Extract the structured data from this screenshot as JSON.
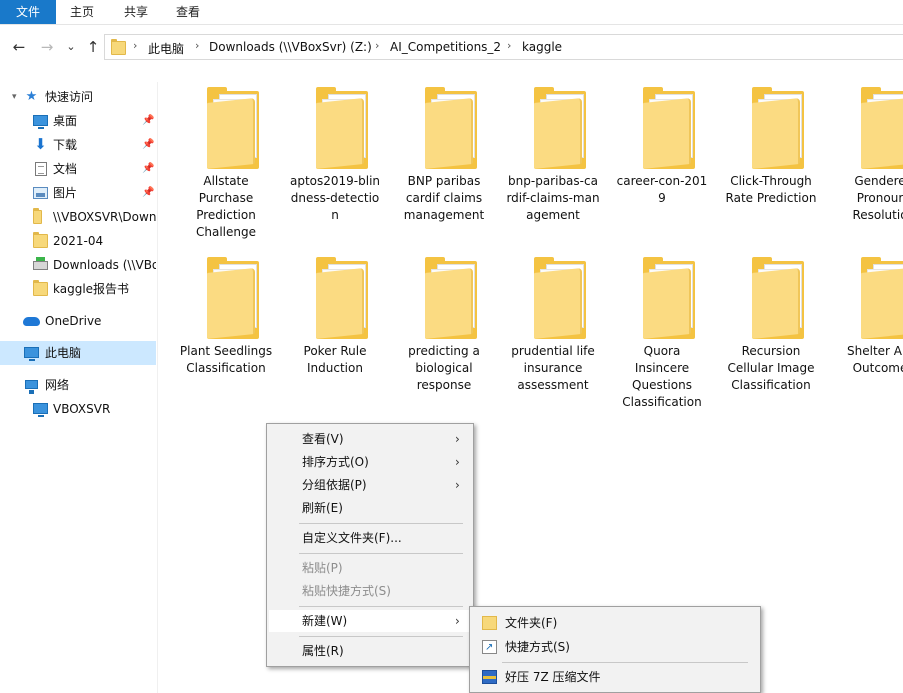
{
  "ribbon": {
    "tabs": [
      "文件",
      "主页",
      "共享",
      "查看"
    ]
  },
  "nav": {
    "back": "←",
    "forward": "→",
    "recent": "⌄",
    "up": "↑"
  },
  "address": {
    "segments": [
      "此电脑",
      "Downloads (\\\\VBoxSvr) (Z:)",
      "AI_Competitions_2",
      "kaggle"
    ],
    "separator": "›"
  },
  "sidebar": {
    "items": [
      {
        "label": "快速访问",
        "icon": "star-icon"
      },
      {
        "label": "桌面",
        "icon": "desktop-icon",
        "pinned": true
      },
      {
        "label": "下载",
        "icon": "download-icon",
        "pinned": true
      },
      {
        "label": "文档",
        "icon": "document-icon",
        "pinned": true
      },
      {
        "label": "图片",
        "icon": "picture-icon",
        "pinned": true
      },
      {
        "label": "\\\\VBOXSVR\\Down",
        "icon": "folder-icon"
      },
      {
        "label": "2021-04",
        "icon": "folder-icon"
      },
      {
        "label": "Downloads (\\\\VBo",
        "icon": "network-drive-icon"
      },
      {
        "label": "kaggle报告书",
        "icon": "folder-icon"
      },
      {
        "label": "OneDrive",
        "icon": "onedrive-icon"
      },
      {
        "label": "此电脑",
        "icon": "this-pc-icon",
        "selected": true
      },
      {
        "label": "网络",
        "icon": "network-icon"
      },
      {
        "label": "VBOXSVR",
        "icon": "computer-icon"
      }
    ],
    "pin_glyph": "📌"
  },
  "folders": [
    "Allstate Purchase Prediction Challenge",
    "aptos2019-blindness-detection",
    "BNP paribas cardif claims management",
    "bnp-paribas-cardif-claims-management",
    "career-con-2019",
    "Click-Through Rate Prediction",
    "Gendered Pronoun Resolution",
    "Plant Seedlings Classification",
    "Poker Rule Induction",
    "predicting a biological response",
    "prudential life insurance assessment",
    "Quora Insincere Questions Classification",
    "Recursion Cellular Image Classification",
    "Shelter Animal Outcomes"
  ],
  "folder_lines": [
    [
      "Allstate",
      "Purchase",
      "Prediction",
      "Challenge"
    ],
    [
      "aptos2019-blin",
      "dness-detectio",
      "n"
    ],
    [
      "BNP paribas",
      "cardif claims",
      "management"
    ],
    [
      "bnp-paribas-ca",
      "rdif-claims-man",
      "agement"
    ],
    [
      "career-con-201",
      "9"
    ],
    [
      "Click-Through",
      "Rate Prediction"
    ],
    [
      "Gendere",
      "Pronour",
      "Resolutio"
    ],
    [
      "Plant Seedlings",
      "Classification"
    ],
    [
      "Poker Rule",
      "Induction"
    ],
    [
      "predicting a",
      "biological",
      "response"
    ],
    [
      "prudential life",
      "insurance",
      "assessment"
    ],
    [
      "Quora",
      "Insincere",
      "Questions",
      "Classification"
    ],
    [
      "Recursion",
      "Cellular Image",
      "Classification"
    ],
    [
      "Shelter Ani",
      "Outcome"
    ]
  ],
  "context_menu": {
    "items": [
      {
        "label": "查看(V)",
        "submenu": true
      },
      {
        "label": "排序方式(O)",
        "submenu": true
      },
      {
        "label": "分组依据(P)",
        "submenu": true
      },
      {
        "label": "刷新(E)"
      },
      {
        "label": "自定义文件夹(F)..."
      },
      {
        "label": "粘贴(P)",
        "disabled": true
      },
      {
        "label": "粘贴快捷方式(S)",
        "disabled": true
      },
      {
        "label": "新建(W)",
        "submenu": true,
        "highlighted": true
      },
      {
        "label": "属性(R)"
      }
    ],
    "arrow": "›"
  },
  "new_submenu": {
    "items": [
      {
        "label": "文件夹(F)",
        "icon": "folder-icon"
      },
      {
        "label": "快捷方式(S)",
        "icon": "shortcut-icon"
      },
      {
        "label": "好压 7Z 压缩文件",
        "icon": "haozip-7z-icon"
      }
    ]
  }
}
